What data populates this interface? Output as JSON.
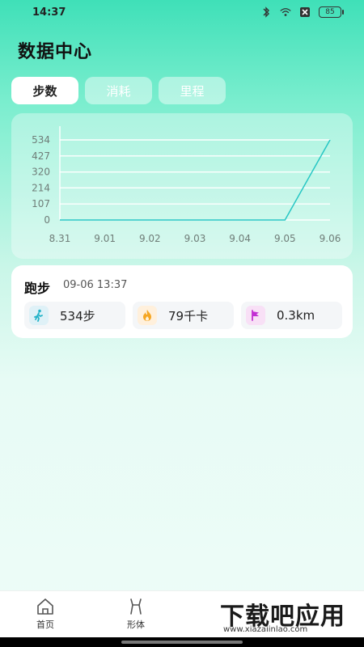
{
  "status_bar": {
    "time": "14:37",
    "icons": [
      "bluetooth-icon",
      "wifi-icon",
      "sim-off-icon",
      "battery-icon"
    ],
    "battery": "85"
  },
  "page": {
    "title": "数据中心"
  },
  "tabs": [
    {
      "label": "步数",
      "active": true
    },
    {
      "label": "消耗",
      "active": false
    },
    {
      "label": "里程",
      "active": false
    }
  ],
  "chart_data": {
    "type": "line",
    "categories": [
      "8.31",
      "9.01",
      "9.02",
      "9.03",
      "9.04",
      "9.05",
      "9.06"
    ],
    "values": [
      0,
      0,
      0,
      0,
      0,
      0,
      534
    ],
    "y_ticks": [
      0,
      107,
      214,
      320,
      427,
      534
    ],
    "ylim": [
      0,
      534
    ],
    "grid": true,
    "line_color": "#26c6c4"
  },
  "record": {
    "title": "跑步",
    "time": "09-06 13:37",
    "stats": [
      {
        "icon": "running-person-icon",
        "value": "534步",
        "color": "#dff1f7",
        "icon_color": "#24b3c8"
      },
      {
        "icon": "flame-icon",
        "value": "79千卡",
        "color": "#fff0dc",
        "icon_color": "#f5a623"
      },
      {
        "icon": "flag-icon",
        "value": "0.3km",
        "color": "#f8e0f6",
        "icon_color": "#c22fd3"
      }
    ]
  },
  "bottom_nav": [
    {
      "label": "首页",
      "icon": "home-icon"
    },
    {
      "label": "形体",
      "icon": "body-icon"
    }
  ],
  "watermark": {
    "text": "下载吧应用",
    "url": "www.xiazaiinlao.com"
  }
}
